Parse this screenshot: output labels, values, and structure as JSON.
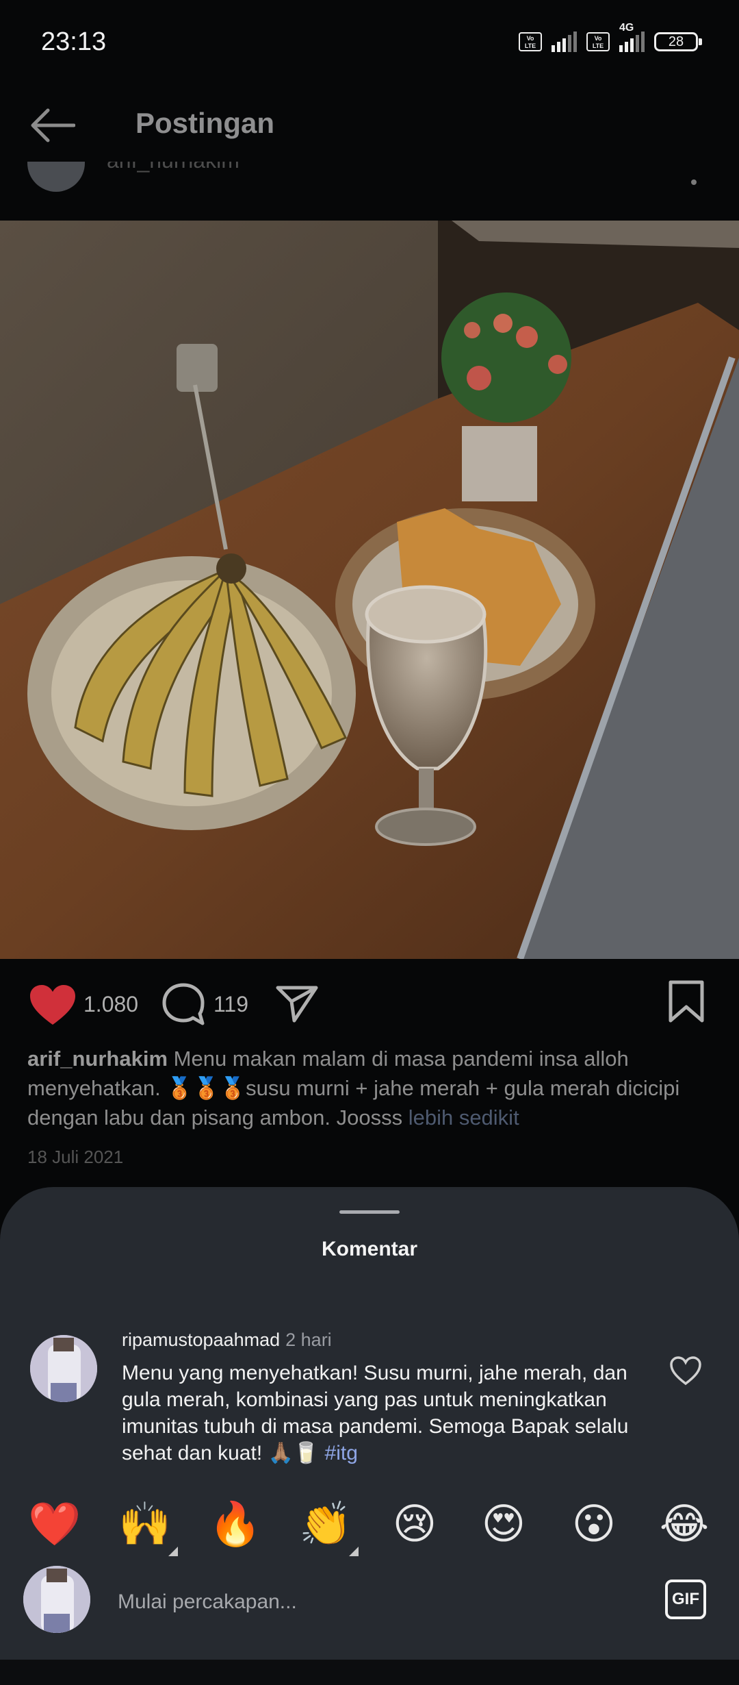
{
  "status_bar": {
    "time": "23:13",
    "volte_label": "Vo\nLTE",
    "network_label": "4G",
    "battery": "28"
  },
  "header": {
    "back_icon": "arrow-left-icon",
    "title": "Postingan"
  },
  "post": {
    "username_cut": "arif_nurhakim",
    "likes": "1.080",
    "comments": "119",
    "caption_user": "arif_nurhakim",
    "caption_text": "Menu makan malam di masa pandemi insa alloh menyehatkan. 🥉🥉🥉susu murni + jahe merah + gula merah dicicipi dengan labu dan pisang ambon. Joosss",
    "caption_more": "lebih sedikit",
    "date": "18 Juli 2021",
    "colors": {
      "like": "#e0313b",
      "link": "#4e5a70"
    }
  },
  "comments_sheet": {
    "title": "Komentar",
    "comment": {
      "user": "ripamustopaahmad",
      "time": "2 hari",
      "text": "Menu yang menyehatkan! Susu murni, jahe merah, dan gula merah, kombinasi yang pas untuk meningkatkan imunitas tubuh di masa pandemi. Semoga Bapak selalu sehat dan kuat! 🙏🏽🥛",
      "hashtag": "#itg"
    },
    "emojis": [
      "❤️",
      "🙌",
      "🔥",
      "👏",
      "😢",
      "😍",
      "😮",
      "😂"
    ],
    "input_placeholder": "Mulai percakapan...",
    "gif_label": "GIF"
  }
}
